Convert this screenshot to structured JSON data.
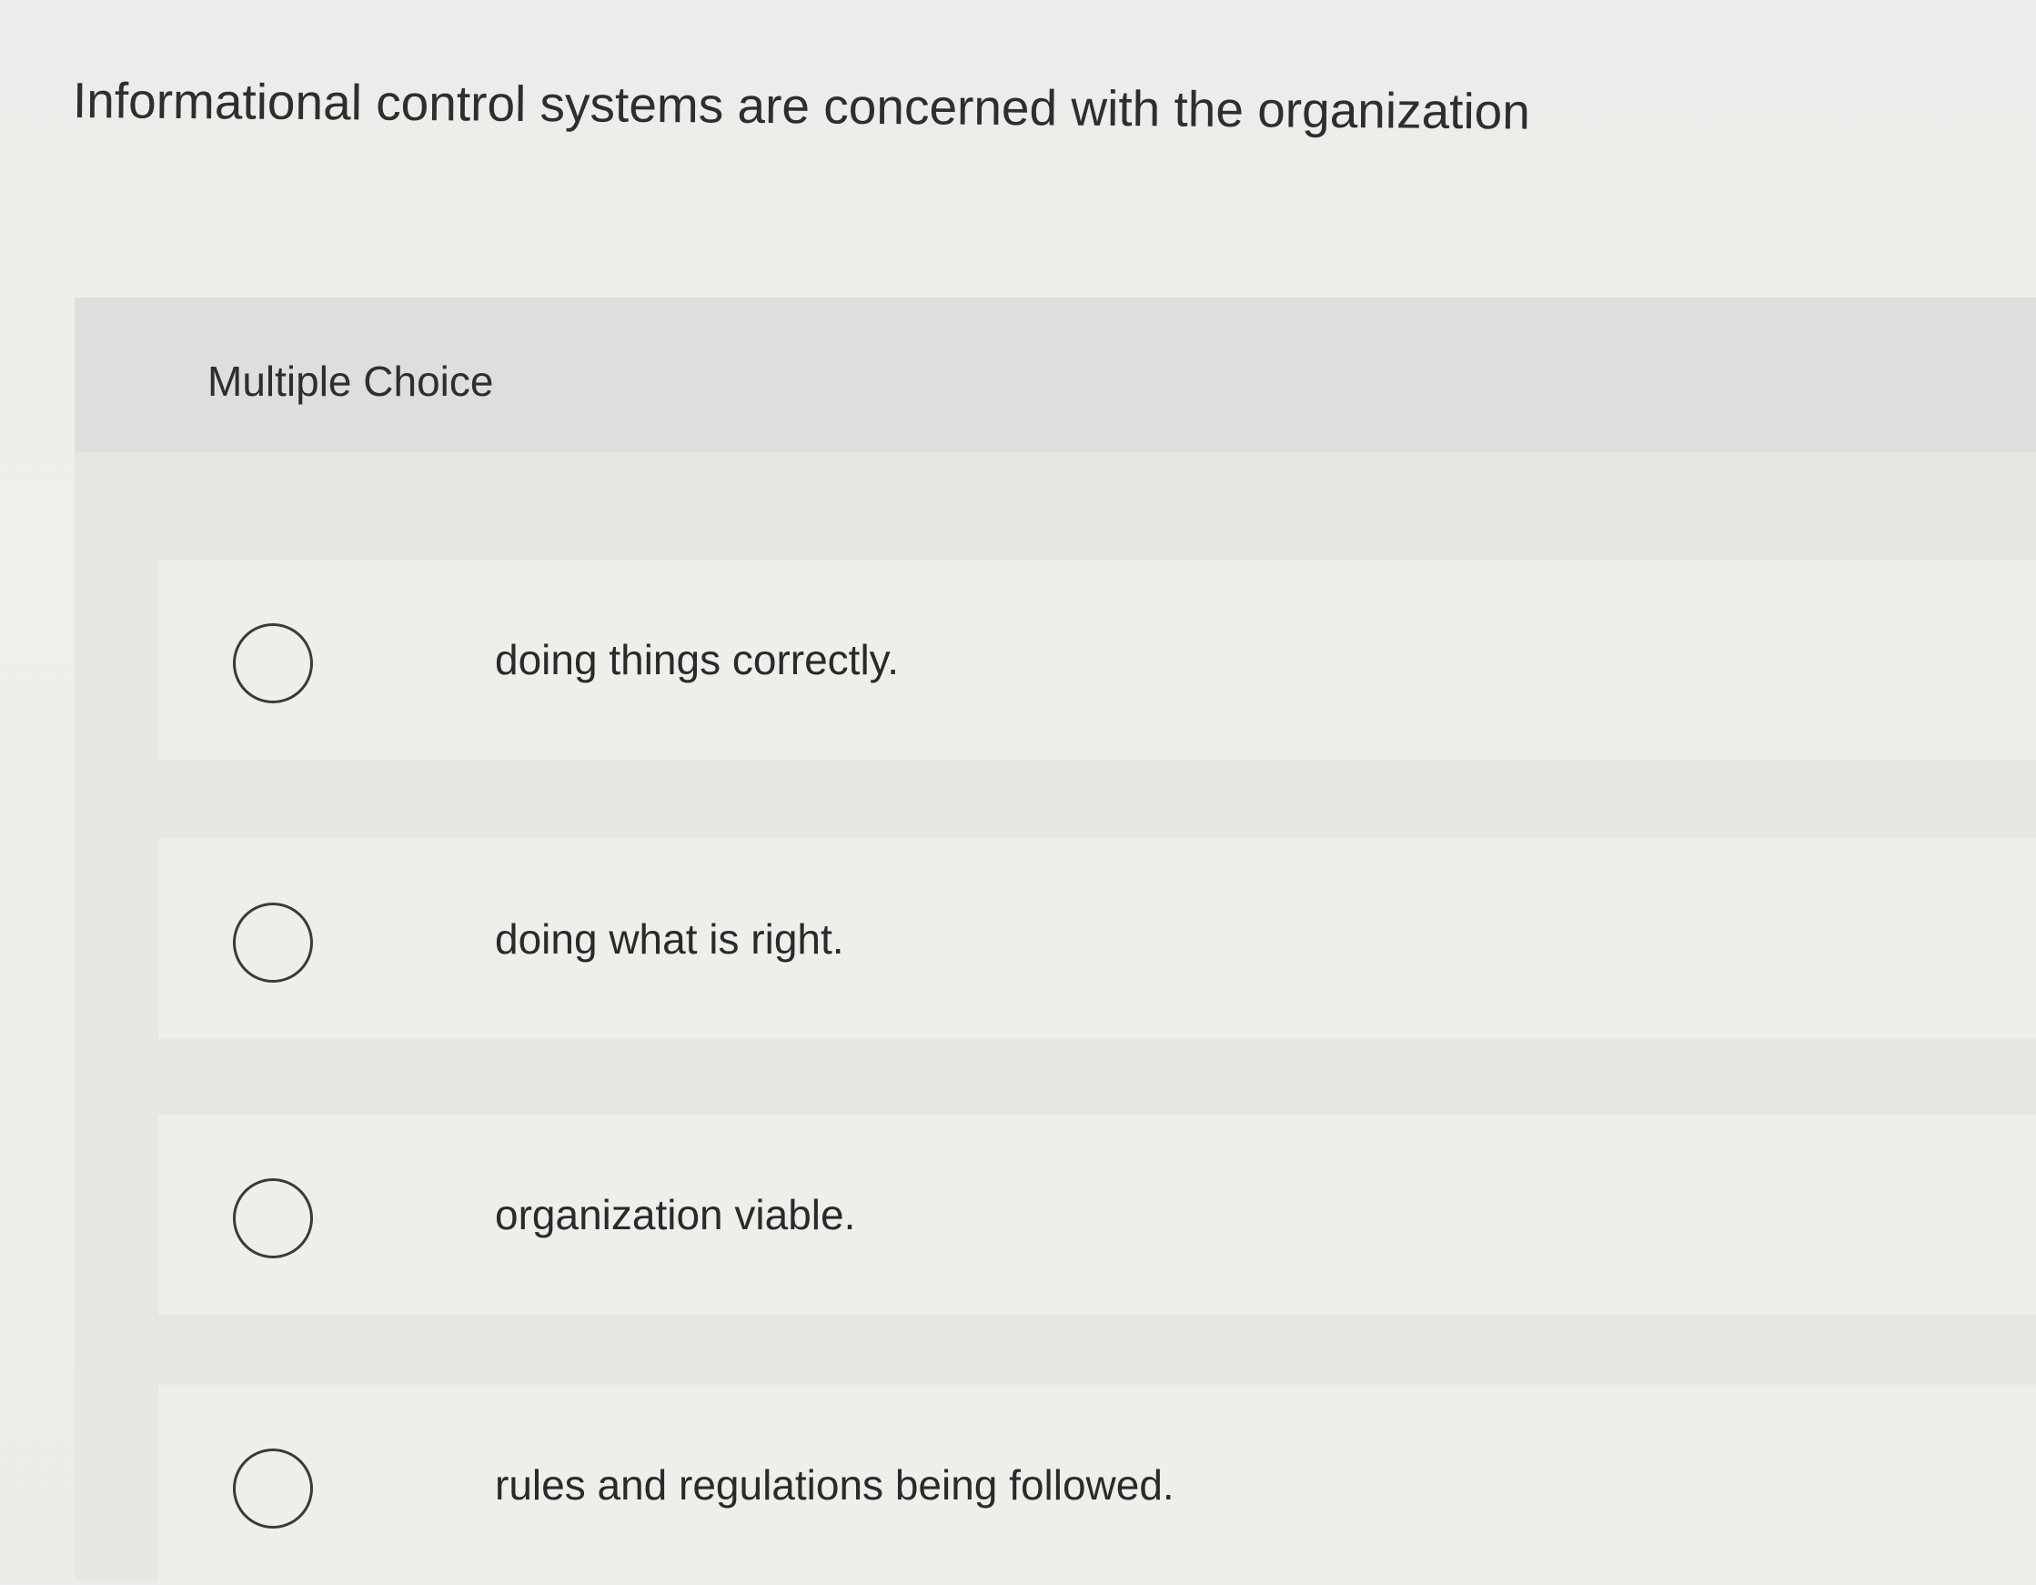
{
  "question": {
    "text": "Informational control systems are concerned with the organization"
  },
  "multiple_choice": {
    "label": "Multiple Choice",
    "options": [
      {
        "text": "doing things correctly."
      },
      {
        "text": "doing what is right."
      },
      {
        "text": "organization viable."
      },
      {
        "text": "rules and regulations being followed."
      }
    ]
  }
}
